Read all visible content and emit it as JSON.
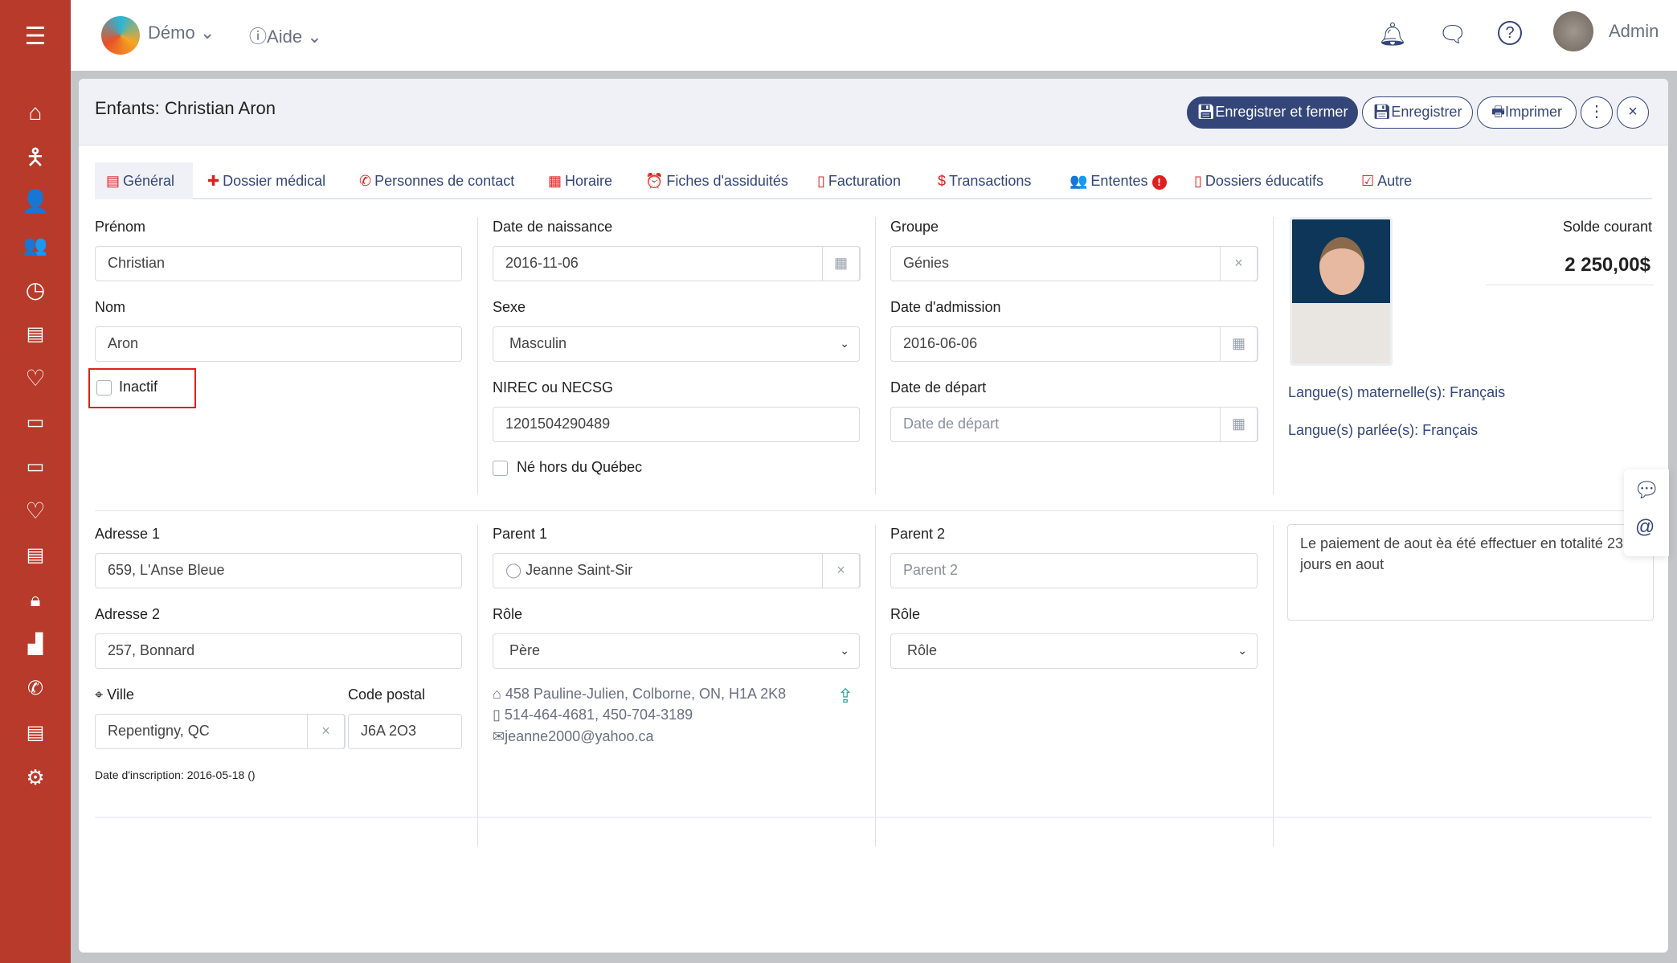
{
  "topbar": {
    "org": "Démo",
    "help": "Aide",
    "user": "Admin",
    "icons": [
      "menu-icon",
      "bell-icon",
      "message-icon",
      "help-icon"
    ]
  },
  "sidebar": {
    "icons": [
      "home-icon",
      "child-icon",
      "person-icon",
      "group-icon",
      "clock-icon",
      "report-icon",
      "heart-icon",
      "id-card-icon",
      "video-icon",
      "heart-outline-icon",
      "chat-icon",
      "lock-icon",
      "building-icon",
      "phone-icon",
      "analytics-icon",
      "settings-icon"
    ]
  },
  "colors": {
    "sidebar": "#b83a2b",
    "accent": "#344679",
    "tab_icon": "#e02020",
    "highlight": "#e02020"
  },
  "header": {
    "title": "Enfants: Christian Aron",
    "save_close": "Enregistrer et fermer",
    "save": "Enregistrer",
    "print": "Imprimer",
    "more": "⋮",
    "close": "×"
  },
  "tabs": [
    {
      "label": "Général",
      "icon": "▤"
    },
    {
      "label": "Dossier médical",
      "icon": "✚"
    },
    {
      "label": "Personnes de contact",
      "icon": "✆"
    },
    {
      "label": "Horaire",
      "icon": "▦"
    },
    {
      "label": "Fiches d'assiduités",
      "icon": "⏰"
    },
    {
      "label": "Facturation",
      "icon": "▯"
    },
    {
      "label": "Transactions",
      "icon": "$"
    },
    {
      "label": "Ententes",
      "icon": "👥"
    },
    {
      "label": "Dossiers éducatifs",
      "icon": "▯"
    },
    {
      "label": "Autre",
      "icon": "☑"
    }
  ],
  "form": {
    "prenom_label": "Prénom",
    "prenom": "Christian",
    "nom_label": "Nom",
    "nom": "Aron",
    "inactif_label": "Inactif",
    "naissance_label": "Date de naissance",
    "naissance": "2016-11-06",
    "sexe_label": "Sexe",
    "sexe": "Masculin",
    "nirec_label": "NIREC ou NECSG",
    "nirec": "1201504290489",
    "hors_quebec_label": "Né hors du Québec",
    "groupe_label": "Groupe",
    "groupe": "Génies",
    "admission_label": "Date d'admission",
    "admission": "2016-06-06",
    "depart_label": "Date de départ",
    "depart_placeholder": "Date de départ",
    "solde_label": "Solde courant",
    "solde": "2 250,00$",
    "langue_maternelle": "Langue(s) maternelle(s): Français",
    "langue_parlee": "Langue(s) parlée(s): Français",
    "adresse1_label": "Adresse 1",
    "adresse1": "659, L'Anse Bleue",
    "adresse2_label": "Adresse 2",
    "adresse2": "257, Bonnard",
    "ville_label": "Ville",
    "ville": "Repentigny, QC",
    "cp_label": "Code postal",
    "cp": "J6A 2O3",
    "parent1_label": "Parent 1",
    "parent1": "Jeanne Saint-Sir",
    "role1_label": "Rôle",
    "role1": "Père",
    "parent1_address": "458 Pauline-Julien, Colborne, ON, H1A 2K8",
    "parent1_phone": "514-464-4681, 450-704-3189",
    "parent1_email": "jeanne2000@yahoo.ca",
    "parent2_label": "Parent 2",
    "parent2_placeholder": "Parent 2",
    "role2_label": "Rôle",
    "role2": "Rôle",
    "note": "Le paiement de aout èa été effectuer en totalité 23 jours en aout",
    "inscription": "Date d'inscription: 2016-05-18 ()"
  }
}
